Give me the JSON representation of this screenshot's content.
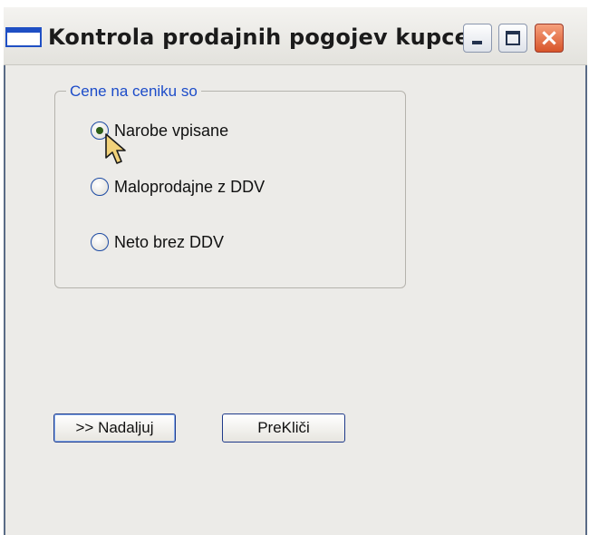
{
  "window": {
    "title": "Kontrola prodajnih pogojev kupcev"
  },
  "title_buttons": {
    "minimize": "minimize",
    "maximize": "maximize",
    "close": "×"
  },
  "price_group": {
    "legend": "Cene na ceniku so",
    "options": [
      {
        "label": "Narobe vpisane",
        "checked": true
      },
      {
        "label": "Maloprodajne z DDV",
        "checked": false
      },
      {
        "label": "Neto brez DDV",
        "checked": false
      }
    ]
  },
  "buttons": {
    "continue": ">> Nadaljuj",
    "cancel": "PreKliči"
  },
  "colors": {
    "accent": "#1c4cc9",
    "window_bg": "#ecebe8",
    "close": "#d8552a"
  }
}
